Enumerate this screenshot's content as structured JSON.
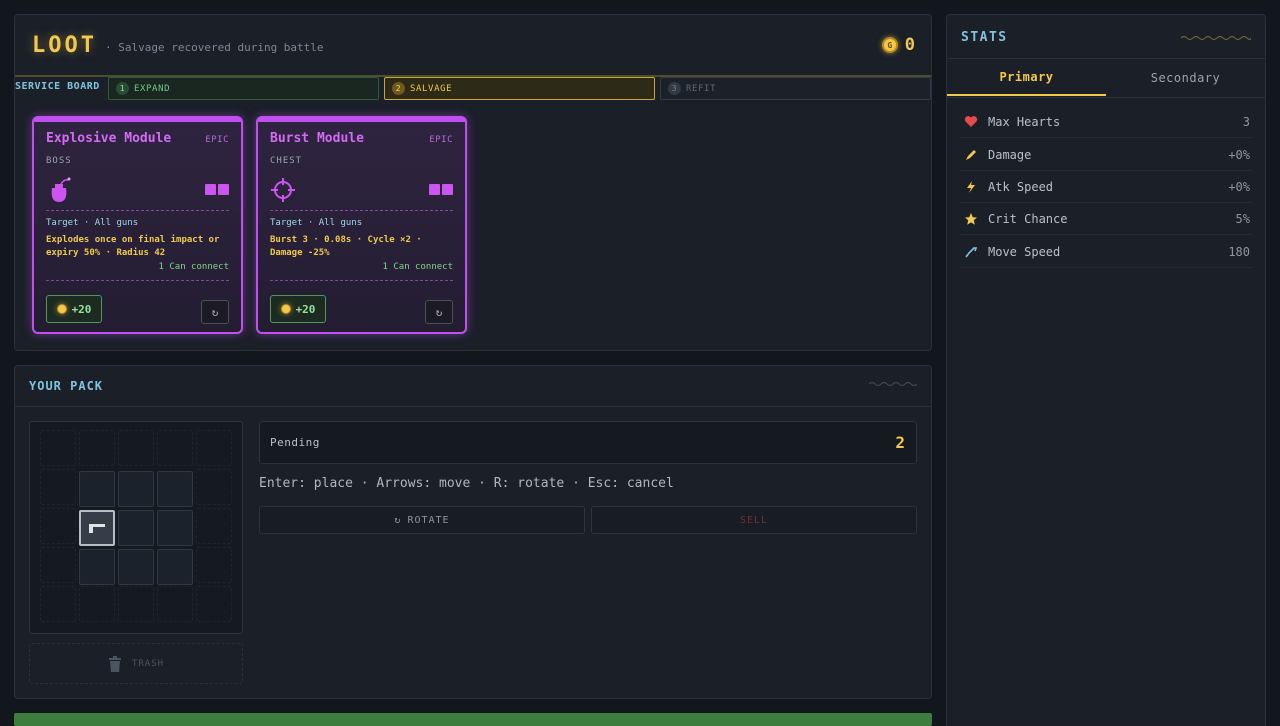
{
  "loot": {
    "title": "LOOT",
    "subtitle": "· Salvage recovered during battle",
    "coins": "0",
    "coin_symbol": "G",
    "service_board_label": "SERVICE BOARD",
    "steps": [
      {
        "num": "1",
        "label": "EXPAND"
      },
      {
        "num": "2",
        "label": "SALVAGE"
      },
      {
        "num": "3",
        "label": "REFIT"
      }
    ],
    "cards": [
      {
        "name": "Explosive Module",
        "rarity": "EPIC",
        "source": "BOSS",
        "icon": "bomb-icon",
        "target": "Target · All guns",
        "description": "Explodes once on final impact or expiry 50% · Radius 42",
        "connect": "1 Can connect",
        "sell": "+20"
      },
      {
        "name": "Burst Module",
        "rarity": "EPIC",
        "source": "CHEST",
        "icon": "crosshair-icon",
        "target": "Target · All guns",
        "description": "Burst 3 · 0.08s · Cycle ×2 · Damage -25%",
        "connect": "1 Can connect",
        "sell": "+20"
      }
    ]
  },
  "pack": {
    "title": "YOUR PACK",
    "trash_label": "TRASH",
    "pending_label": "Pending",
    "pending_value": "2",
    "help": "Enter: place · Arrows: move · R: rotate · Esc: cancel",
    "rotate_label": "ROTATE",
    "sell_label": "SELL"
  },
  "stats": {
    "title": "STATS",
    "tabs": [
      "Primary",
      "Secondary"
    ],
    "rows": [
      {
        "icon": "heart-icon",
        "name": "Max Hearts",
        "value": "3",
        "color": "#e84a4a"
      },
      {
        "icon": "sword-icon",
        "name": "Damage",
        "value": "+0%",
        "color": "#f4c84a"
      },
      {
        "icon": "lightning-icon",
        "name": "Atk Speed",
        "value": "+0%",
        "color": "#f4c84a"
      },
      {
        "icon": "star-icon",
        "name": "Crit Chance",
        "value": "5%",
        "color": "#f4c84a"
      },
      {
        "icon": "boot-icon",
        "name": "Move Speed",
        "value": "180",
        "color": "#7fc4de"
      }
    ]
  },
  "colors": {
    "gold": "#f4c84a",
    "epic": "#c04ef0",
    "cyan": "#7fc4de",
    "green": "#3c7d3e"
  }
}
